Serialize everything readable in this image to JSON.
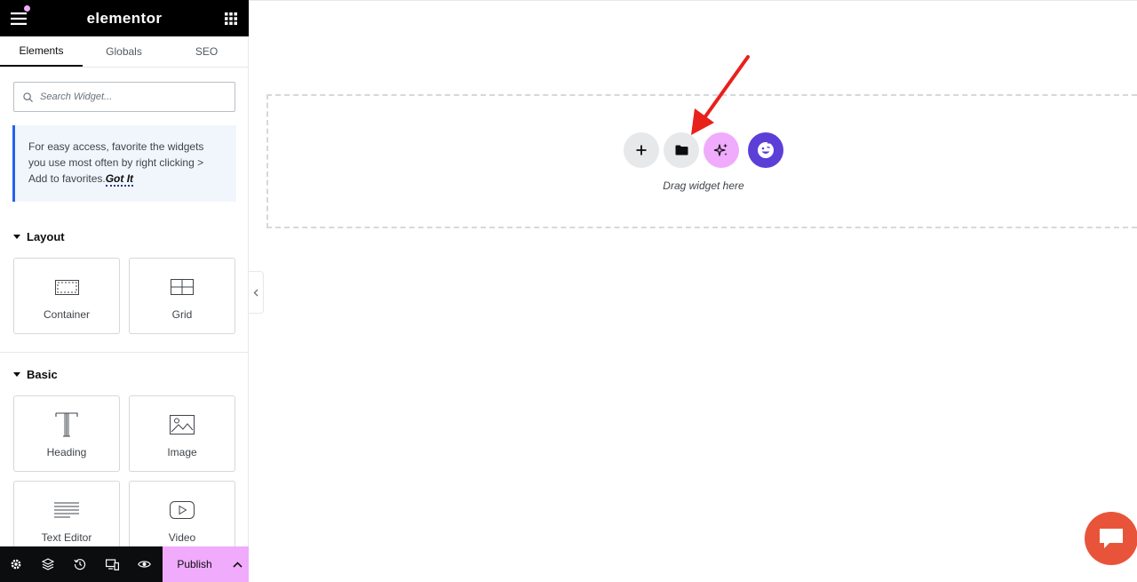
{
  "topbar": {
    "logo": "elementor"
  },
  "tabs": [
    {
      "label": "Elements",
      "active": true
    },
    {
      "label": "Globals",
      "active": false
    },
    {
      "label": "SEO",
      "active": false
    }
  ],
  "search": {
    "placeholder": "Search Widget..."
  },
  "notice": {
    "text": "For easy access, favorite the widgets you use most often by right clicking > Add to favorites.",
    "link": "Got It"
  },
  "sections": {
    "layout": {
      "title": "Layout",
      "widgets": [
        {
          "label": "Container",
          "icon": "container-icon"
        },
        {
          "label": "Grid",
          "icon": "grid-icon"
        }
      ]
    },
    "basic": {
      "title": "Basic",
      "widgets": [
        {
          "label": "Heading",
          "icon": "heading-icon"
        },
        {
          "label": "Image",
          "icon": "image-icon"
        },
        {
          "label": "Text Editor",
          "icon": "text-editor-icon"
        },
        {
          "label": "Video",
          "icon": "video-icon"
        }
      ]
    }
  },
  "bottombar": {
    "icons": [
      "settings-icon",
      "layers-icon",
      "history-icon",
      "responsive-icon",
      "preview-icon"
    ],
    "publish_label": "Publish"
  },
  "canvas": {
    "drag_text": "Drag widget here",
    "buttons": [
      "add-icon",
      "folder-icon",
      "ai-sparkle-icon",
      "template-kit-icon"
    ]
  },
  "colors": {
    "accent_pink": "#f0abfc",
    "notice_border": "#2563eb",
    "kit_purple": "#5b3fd6",
    "chat_orange": "#e8543a",
    "arrow_red": "#e8211b"
  }
}
